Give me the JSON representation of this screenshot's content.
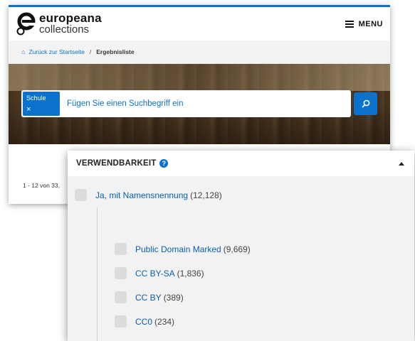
{
  "header": {
    "logo_line1": "europeana",
    "logo_line2": "collections",
    "menu_label": "MENU",
    "accent_color": "#0a72cc"
  },
  "breadcrumb": {
    "home_icon": "home-icon",
    "back_label": "Zurück zur Startseite",
    "separator": "/",
    "current": "Ergebnisliste"
  },
  "search": {
    "chip_label": "Schule",
    "chip_remove": "×",
    "placeholder": "Fügen Sie einen Suchbegriff ein",
    "button_icon": "search-icon"
  },
  "results": {
    "count_text": "1 - 12 von 33,"
  },
  "filter": {
    "title": "VERWENDBARKEIT",
    "help_icon": "question-circle-icon",
    "collapse_icon": "caret-up-icon",
    "parent_option": {
      "label": "Ja, mit Namensnennung",
      "count": "(12,128)"
    },
    "options": [
      {
        "label": "Public Domain Marked",
        "count": "(9,669)"
      },
      {
        "label": "CC BY-SA",
        "count": "(1,836)"
      },
      {
        "label": "CC BY",
        "count": "(389)"
      },
      {
        "label": "CC0",
        "count": "(234)"
      }
    ]
  }
}
